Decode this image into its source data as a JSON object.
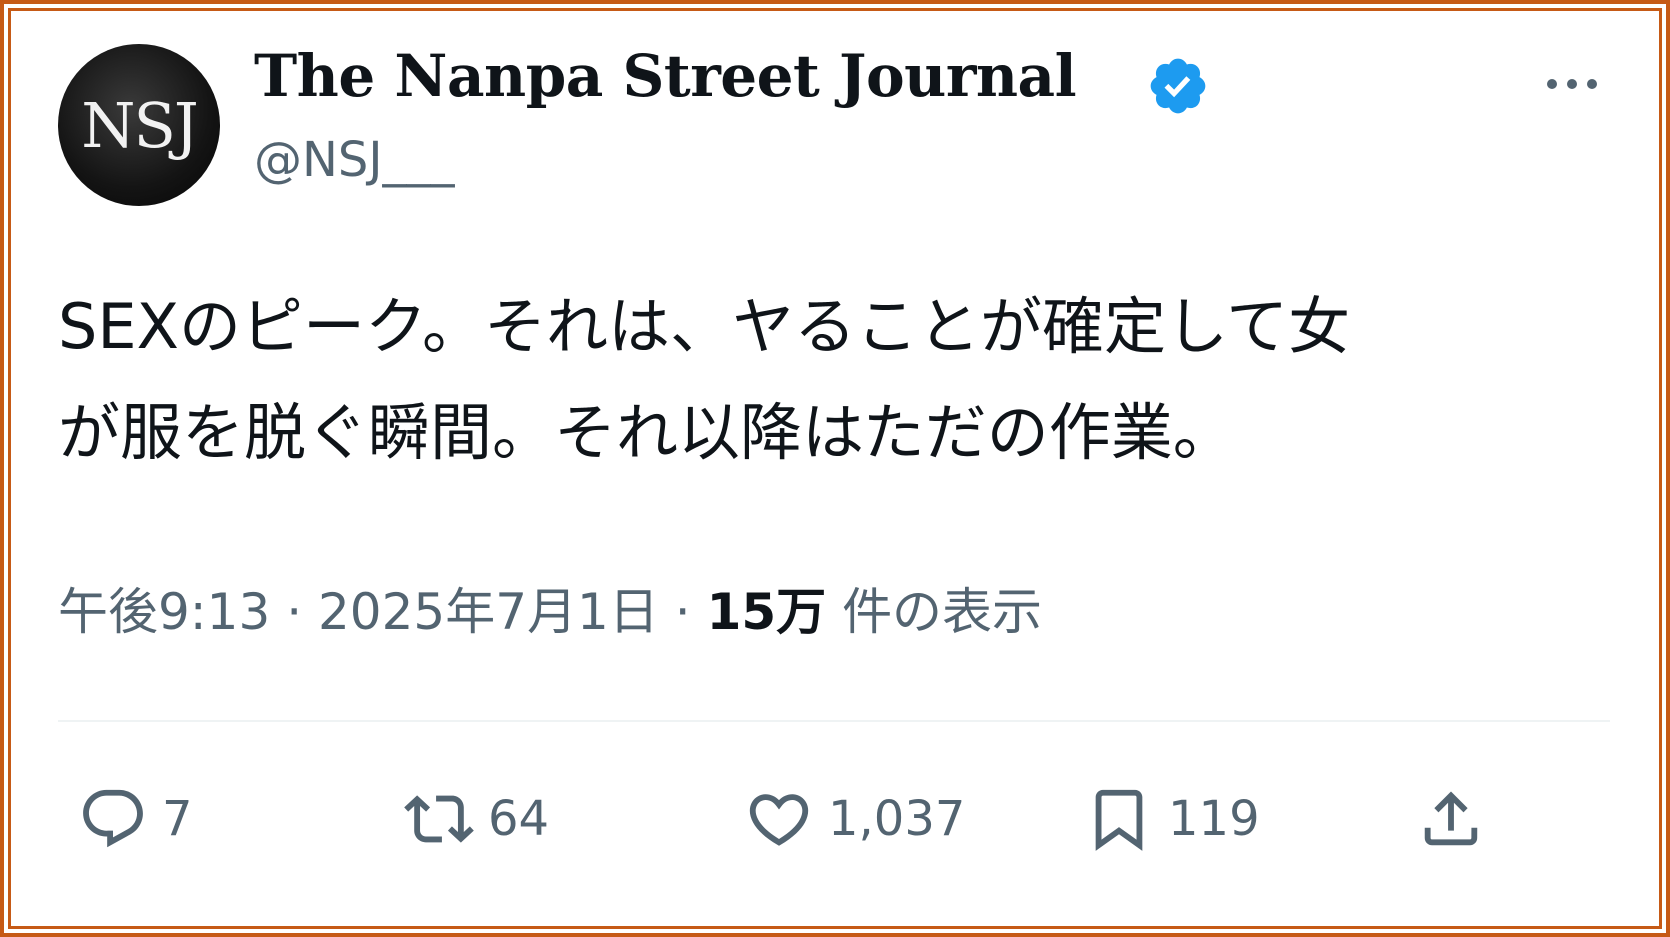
{
  "author": {
    "avatar_text": "NSJ",
    "display_name": "The Nanpa Street Journal",
    "handle": "@NSJ___",
    "verified_icon": "verified-badge-icon"
  },
  "tweet": {
    "line1": "SEXのピーク。それは、ヤることが確定して女",
    "line2": "が服を脱ぐ瞬間。それ以降はただの作業。"
  },
  "meta": {
    "time": "午後9:13",
    "date": "2025年7月1日",
    "views_count": "15万",
    "views_label": "件の表示"
  },
  "actions": {
    "reply_count": "7",
    "retweet_count": "64",
    "like_count": "1,037",
    "bookmark_count": "119"
  },
  "colors": {
    "frame": "#c65a16",
    "text": "#0f1419",
    "secondary": "#536471",
    "verified": "#1d9bf0"
  }
}
